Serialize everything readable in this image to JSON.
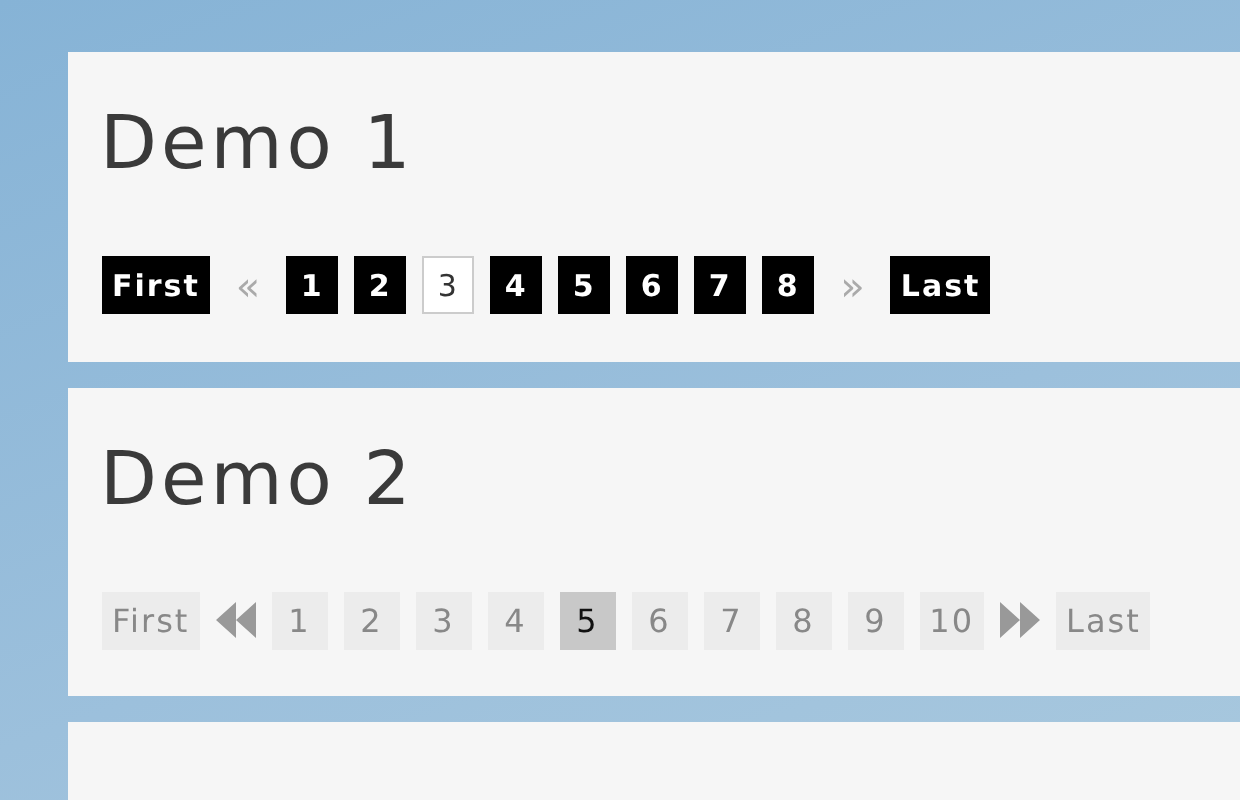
{
  "demos": [
    {
      "title": "Demo 1",
      "kind": "dark",
      "pager": [
        {
          "kind": "label",
          "text": "First"
        },
        {
          "kind": "arrow",
          "text": "«"
        },
        {
          "kind": "page",
          "text": "1",
          "selected": false
        },
        {
          "kind": "page",
          "text": "2",
          "selected": false
        },
        {
          "kind": "page",
          "text": "3",
          "selected": true
        },
        {
          "kind": "page",
          "text": "4",
          "selected": false
        },
        {
          "kind": "page",
          "text": "5",
          "selected": false
        },
        {
          "kind": "page",
          "text": "6",
          "selected": false
        },
        {
          "kind": "page",
          "text": "7",
          "selected": false
        },
        {
          "kind": "page",
          "text": "8",
          "selected": false
        },
        {
          "kind": "arrow",
          "text": "»"
        },
        {
          "kind": "label",
          "text": "Last"
        }
      ]
    },
    {
      "title": "Demo 2",
      "kind": "light",
      "pager": [
        {
          "kind": "label",
          "text": "First"
        },
        {
          "kind": "prev-icon"
        },
        {
          "kind": "page",
          "text": "1",
          "selected": false
        },
        {
          "kind": "page",
          "text": "2",
          "selected": false
        },
        {
          "kind": "page",
          "text": "3",
          "selected": false
        },
        {
          "kind": "page",
          "text": "4",
          "selected": false
        },
        {
          "kind": "page",
          "text": "5",
          "selected": true
        },
        {
          "kind": "page",
          "text": "6",
          "selected": false
        },
        {
          "kind": "page",
          "text": "7",
          "selected": false
        },
        {
          "kind": "page",
          "text": "8",
          "selected": false
        },
        {
          "kind": "page",
          "text": "9",
          "selected": false
        },
        {
          "kind": "page",
          "text": "10",
          "selected": false
        },
        {
          "kind": "next-icon"
        },
        {
          "kind": "label",
          "text": "Last"
        }
      ]
    },
    {
      "kind": "empty"
    }
  ]
}
